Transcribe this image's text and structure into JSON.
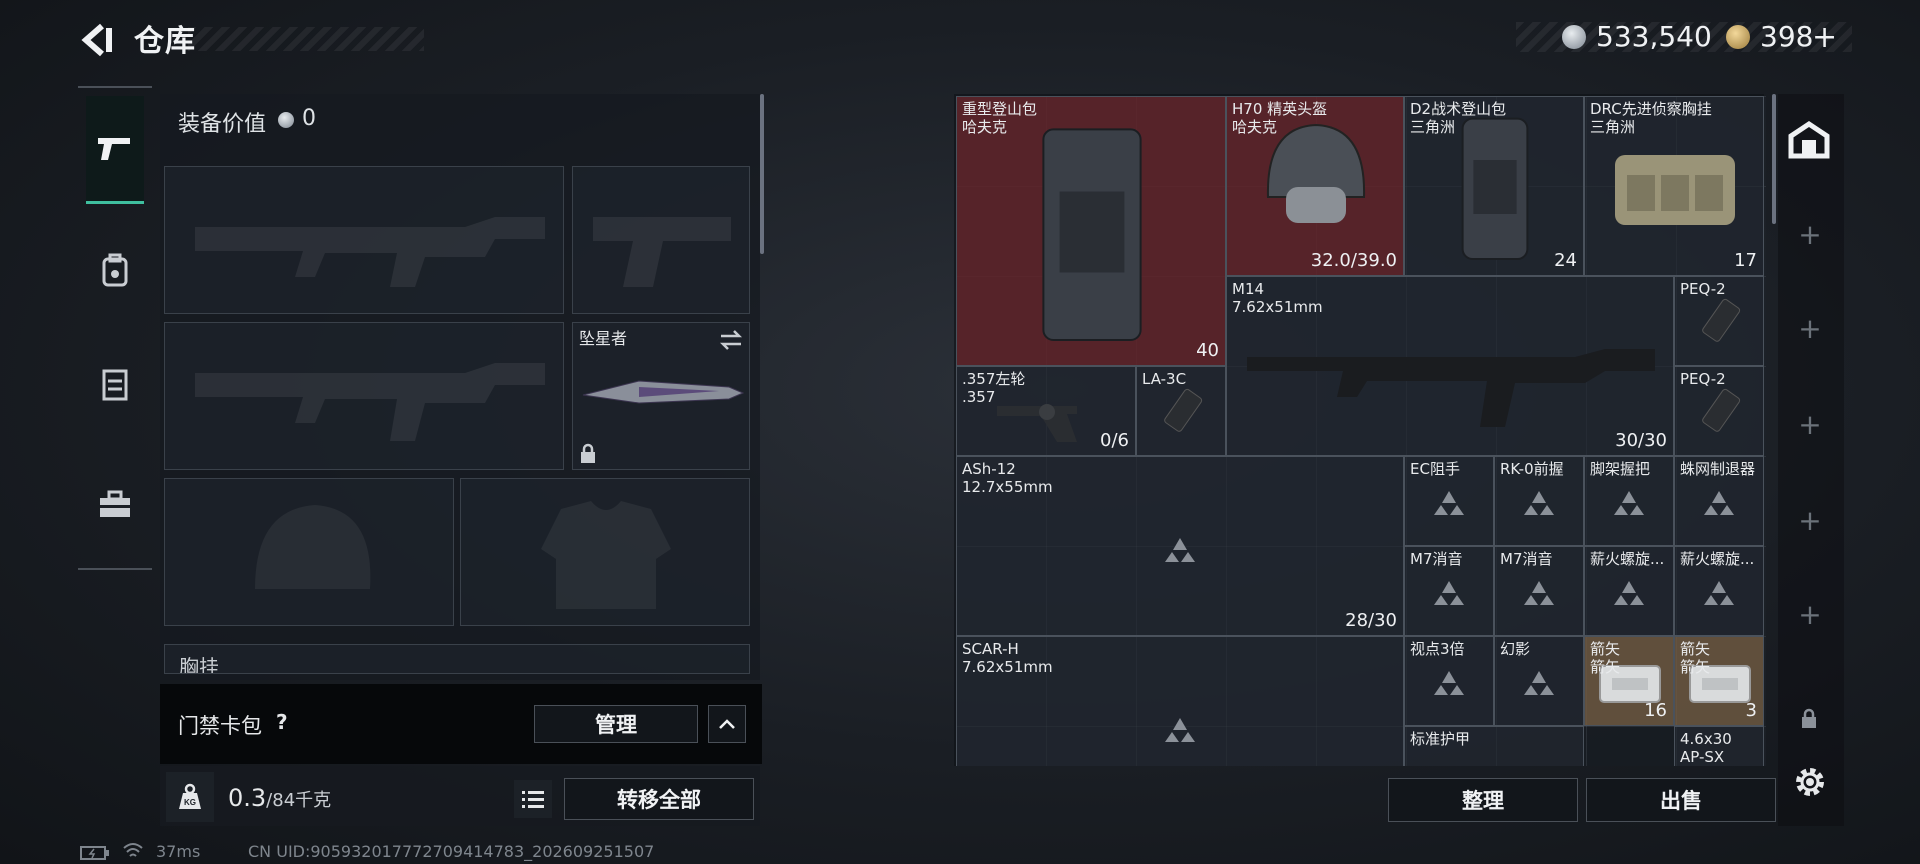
{
  "header": {
    "title": "仓库",
    "currency_silver": "533,540",
    "currency_gold": "398",
    "gold_plus": "+"
  },
  "tabs": [
    {
      "icon": "pistol-icon",
      "active": true
    },
    {
      "icon": "backpack-icon",
      "active": false
    },
    {
      "icon": "vest-icon",
      "active": false
    },
    {
      "icon": "toolbox-icon",
      "active": false
    }
  ],
  "equipment": {
    "value_label": "装备价值",
    "value": "0",
    "melee_slot_name": "坠星者",
    "chest_rig_label": "胸挂"
  },
  "keycard": {
    "label": "门禁卡包",
    "help": "?",
    "manage_label": "管理"
  },
  "weight": {
    "current": "0.3",
    "max": "/84千克",
    "transfer_all_label": "转移全部"
  },
  "status": {
    "ping": "37ms",
    "uid": "CN UID:905932017772709414783_202609251507"
  },
  "grid_items": [
    {
      "name": "重型登山包",
      "sub": "哈夫克",
      "count": "40",
      "color": "red"
    },
    {
      "name": "H70 精英头盔",
      "sub": "哈夫克",
      "count": "32.0/39.0",
      "color": "red"
    },
    {
      "name": "D2战术登山包",
      "sub": "三角洲",
      "count": "24"
    },
    {
      "name": "DRC先进侦察胸挂",
      "sub": "三角洲",
      "count": "17"
    },
    {
      "name": "M14",
      "sub": "7.62x51mm",
      "count": "30/30"
    },
    {
      "name": "PEQ-2",
      "sub": ""
    },
    {
      "name": "PEQ-2",
      "sub": ""
    },
    {
      "name": ".357左轮",
      "sub": ".357",
      "count": "0/6"
    },
    {
      "name": "LA-3C",
      "sub": ""
    },
    {
      "name": "ASh-12",
      "sub": "12.7x55mm",
      "count": "28/30"
    },
    {
      "name": "EC阻手",
      "sub": ""
    },
    {
      "name": "RK-0前握",
      "sub": ""
    },
    {
      "name": "脚架握把",
      "sub": ""
    },
    {
      "name": "蛛网制退器",
      "sub": ""
    },
    {
      "name": "M7消音",
      "sub": ""
    },
    {
      "name": "M7消音",
      "sub": ""
    },
    {
      "name": "薪火螺旋...",
      "sub": ""
    },
    {
      "name": "薪火螺旋...",
      "sub": ""
    },
    {
      "name": "SCAR-H",
      "sub": "7.62x51mm"
    },
    {
      "name": "视点3倍",
      "sub": ""
    },
    {
      "name": "幻影",
      "sub": ""
    },
    {
      "name": "箭矢",
      "sub": "箭矢",
      "count": "16",
      "color": "gold"
    },
    {
      "name": "箭矢",
      "sub": "箭矢",
      "count": "3",
      "color": "gold"
    },
    {
      "name": "标准护甲",
      "sub": ""
    },
    {
      "name": "4.6x30",
      "sub": "AP-SX"
    }
  ],
  "actions": {
    "sort_label": "整理",
    "sell_label": "出售"
  }
}
